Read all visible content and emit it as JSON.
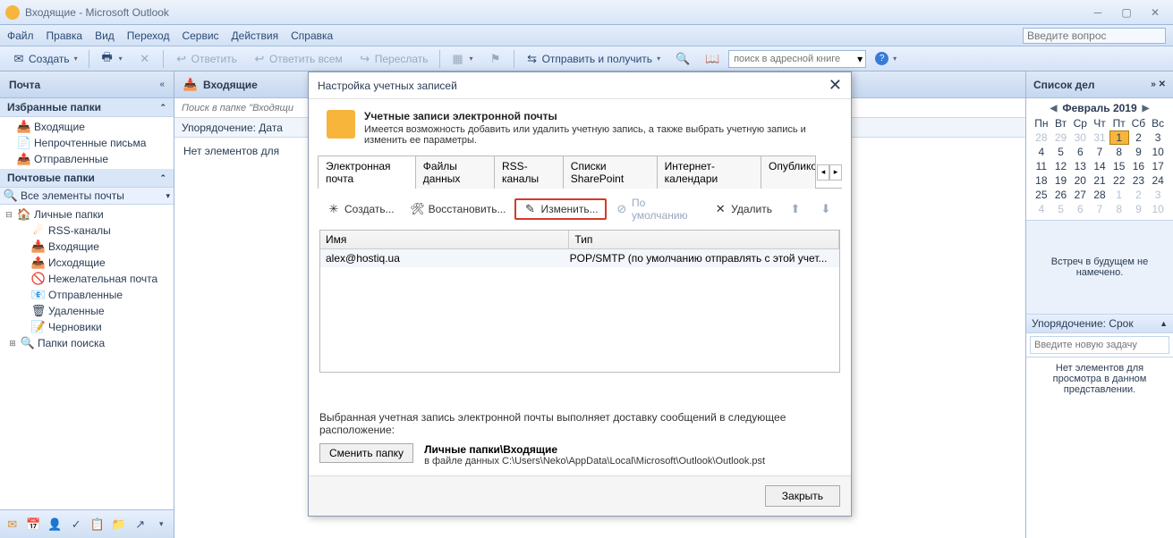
{
  "titlebar": {
    "title": "Входящие - Microsoft Outlook"
  },
  "menubar": {
    "items": [
      "Файл",
      "Правка",
      "Вид",
      "Переход",
      "Сервис",
      "Действия",
      "Справка"
    ],
    "ask_placeholder": "Введите вопрос"
  },
  "toolbar": {
    "create": "Создать",
    "reply": "Ответить",
    "reply_all": "Ответить всем",
    "forward": "Переслать",
    "sendreceive": "Отправить и получить",
    "search_placeholder": "поиск в адресной книге"
  },
  "nav": {
    "header": "Почта",
    "fav_section": "Избранные папки",
    "fav": [
      "Входящие",
      "Непрочтенные письма",
      "Отправленные"
    ],
    "mail_section": "Почтовые папки",
    "all_items": "Все элементы почты",
    "personal": "Личные папки",
    "tree": [
      "RSS-каналы",
      "Входящие",
      "Исходящие",
      "Нежелательная почта",
      "Отправленные",
      "Удаленные",
      "Черновики",
      "Папки поиска"
    ]
  },
  "content": {
    "header": "Входящие",
    "search_placeholder": "Поиск в папке \"Входящи",
    "sort_label": "Упорядочение: Дата",
    "empty": "Нет элементов для"
  },
  "todo": {
    "header": "Список дел",
    "cal_month": "Февраль 2019",
    "dow": [
      "Пн",
      "Вт",
      "Ср",
      "Чт",
      "Пт",
      "Сб",
      "Вс"
    ],
    "weeks": [
      [
        {
          "d": "28",
          "o": true
        },
        {
          "d": "29",
          "o": true
        },
        {
          "d": "30",
          "o": true
        },
        {
          "d": "31",
          "o": true
        },
        {
          "d": "1",
          "today": true
        },
        {
          "d": "2"
        },
        {
          "d": "3"
        }
      ],
      [
        {
          "d": "4"
        },
        {
          "d": "5"
        },
        {
          "d": "6"
        },
        {
          "d": "7"
        },
        {
          "d": "8"
        },
        {
          "d": "9"
        },
        {
          "d": "10"
        }
      ],
      [
        {
          "d": "11"
        },
        {
          "d": "12"
        },
        {
          "d": "13"
        },
        {
          "d": "14"
        },
        {
          "d": "15"
        },
        {
          "d": "16"
        },
        {
          "d": "17"
        }
      ],
      [
        {
          "d": "18"
        },
        {
          "d": "19"
        },
        {
          "d": "20"
        },
        {
          "d": "21"
        },
        {
          "d": "22"
        },
        {
          "d": "23"
        },
        {
          "d": "24"
        }
      ],
      [
        {
          "d": "25"
        },
        {
          "d": "26"
        },
        {
          "d": "27"
        },
        {
          "d": "28"
        },
        {
          "d": "1",
          "o": true
        },
        {
          "d": "2",
          "o": true
        },
        {
          "d": "3",
          "o": true
        }
      ],
      [
        {
          "d": "4",
          "o": true
        },
        {
          "d": "5",
          "o": true
        },
        {
          "d": "6",
          "o": true
        },
        {
          "d": "7",
          "o": true
        },
        {
          "d": "8",
          "o": true
        },
        {
          "d": "9",
          "o": true
        },
        {
          "d": "10",
          "o": true
        }
      ]
    ],
    "no_meetings": "Встреч в будущем не намечено.",
    "task_sort": "Упорядочение: Срок",
    "task_input_placeholder": "Введите новую задачу",
    "task_empty": "Нет элементов для просмотра в данном представлении."
  },
  "dialog": {
    "title": "Настройка учетных записей",
    "heading": "Учетные записи электронной почты",
    "desc": "Имеется возможность добавить или удалить учетную запись, а также выбрать учетную запись и изменить ее параметры.",
    "tabs": [
      "Электронная почта",
      "Файлы данных",
      "RSS-каналы",
      "Списки SharePoint",
      "Интернет-календари",
      "Опубликова"
    ],
    "tb": {
      "create": "Создать...",
      "repair": "Восстановить...",
      "edit": "Изменить...",
      "default": "По умолчанию",
      "delete": "Удалить"
    },
    "cols": {
      "name": "Имя",
      "type": "Тип"
    },
    "row": {
      "name": "alex@hostiq.ua",
      "type": "POP/SMTP (по умолчанию отправлять с этой учет..."
    },
    "delivery_info": "Выбранная учетная запись электронной почты выполняет доставку сообщений в следующее расположение:",
    "change_folder": "Сменить папку",
    "location_title": "Личные папки\\Входящие",
    "location_path": "в файле данных C:\\Users\\Neko\\AppData\\Local\\Microsoft\\Outlook\\Outlook.pst",
    "close": "Закрыть"
  }
}
